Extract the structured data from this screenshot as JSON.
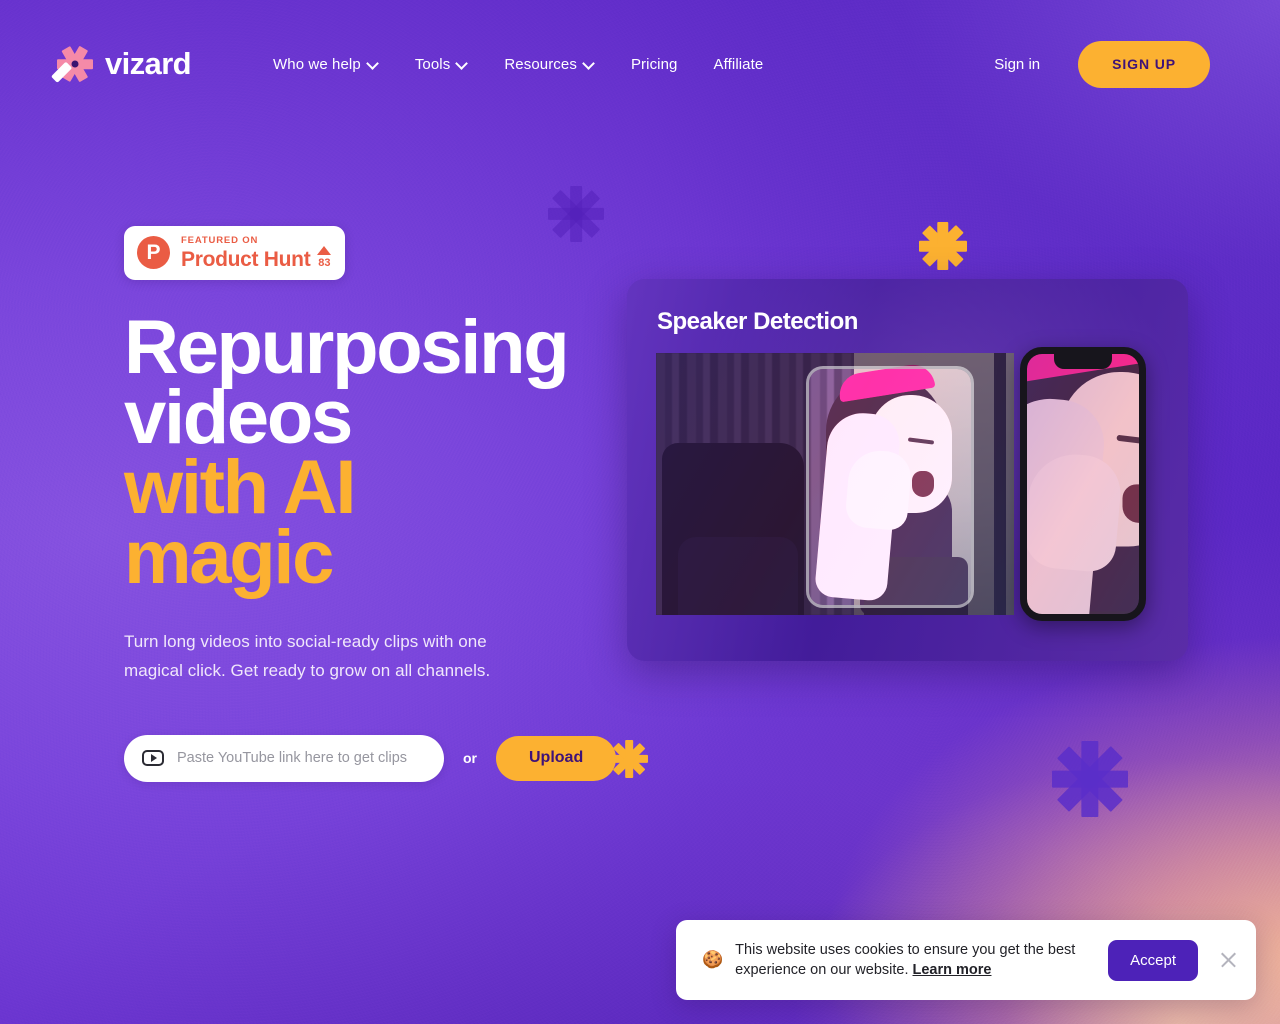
{
  "brand": {
    "name": "vizard",
    "logo_icon": "asterisk-wand-icon",
    "logo_color": "#f58aa8"
  },
  "nav": {
    "items": [
      {
        "label": "Who we help",
        "has_dropdown": true
      },
      {
        "label": "Tools",
        "has_dropdown": true
      },
      {
        "label": "Resources",
        "has_dropdown": true
      },
      {
        "label": "Pricing",
        "has_dropdown": false
      },
      {
        "label": "Affiliate",
        "has_dropdown": false
      }
    ],
    "sign_in": "Sign in",
    "sign_up": "SIGN UP"
  },
  "hero": {
    "badge": {
      "featured_on": "FEATURED ON",
      "product": "Product Hunt",
      "upvotes": "83",
      "logo_letter": "P",
      "accent_color": "#ea5c44"
    },
    "headline_line1": "Repurposing",
    "headline_line2": "videos",
    "headline_accent_line1": "with AI",
    "headline_accent_line2": "magic",
    "subheading": "Turn long videos into social-ready clips with one magical click. Get ready to grow on all channels.",
    "input_placeholder": "Paste YouTube link here to get clips",
    "input_value": "",
    "input_icon": "youtube-icon",
    "or_label": "or",
    "upload_label": "Upload"
  },
  "showcase": {
    "title": "Speaker Detection",
    "landscape_alt": "woman with pink headphones singing",
    "phone_alt": "vertical crop of speaker on phone"
  },
  "cookie": {
    "emoji": "🍪",
    "message": "This website uses cookies to ensure you get the best experience on our website. ",
    "learn_more": "Learn more",
    "accept": "Accept",
    "close_icon": "close-icon"
  },
  "colors": {
    "brand_purple": "#5a27c4",
    "accent_amber": "#fcb131",
    "logo_pink": "#f58aa8",
    "cookie_accept": "#4d22b8"
  }
}
